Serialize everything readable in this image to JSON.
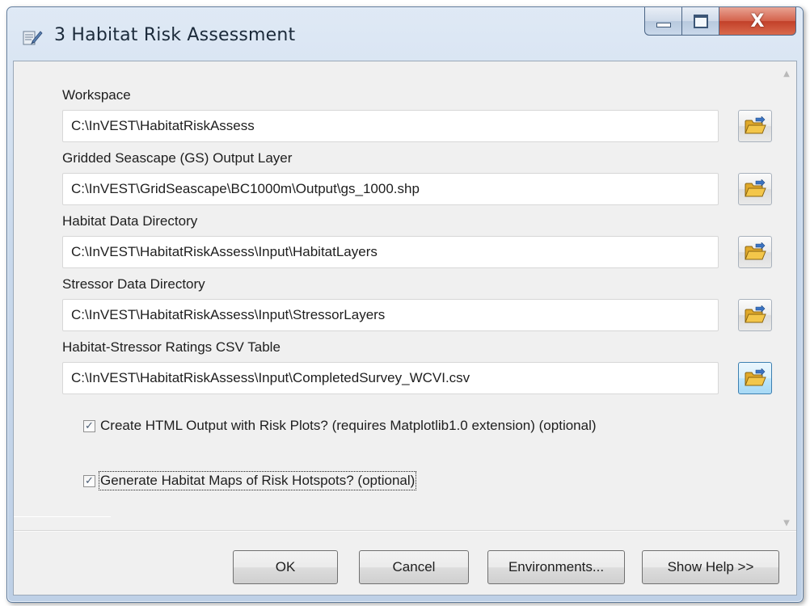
{
  "window": {
    "title": "3 Habitat Risk Assessment",
    "close_glyph": "X"
  },
  "fields": [
    {
      "label": "Workspace",
      "value": "C:\\InVEST\\HabitatRiskAssess"
    },
    {
      "label": "Gridded Seascape (GS) Output Layer",
      "value": "C:\\InVEST\\GridSeascape\\BC1000m\\Output\\gs_1000.shp"
    },
    {
      "label": "Habitat Data Directory",
      "value": "C:\\InVEST\\HabitatRiskAssess\\Input\\HabitatLayers"
    },
    {
      "label": "Stressor Data Directory",
      "value": "C:\\InVEST\\HabitatRiskAssess\\Input\\StressorLayers"
    },
    {
      "label": "Habitat-Stressor Ratings CSV Table",
      "value": "C:\\InVEST\\HabitatRiskAssess\\Input\\CompletedSurvey_WCVI.csv"
    }
  ],
  "checkboxes": [
    {
      "label": "Create HTML Output with Risk Plots? (requires Matplotlib1.0 extension) (optional)",
      "checked": true,
      "mark": "✓"
    },
    {
      "label": "Generate Habitat Maps of Risk Hotspots? (optional)",
      "checked": true,
      "mark": "✓"
    }
  ],
  "buttons": {
    "ok": "OK",
    "cancel": "Cancel",
    "environments": "Environments...",
    "help": "Show Help >>"
  },
  "icons": {
    "window": "tool-icon",
    "browse": "open-folder-icon"
  },
  "colors": {
    "close_button": "#c2402a",
    "folder_yellow": "#f3c64a",
    "focused_browse": "#bee6fd"
  }
}
